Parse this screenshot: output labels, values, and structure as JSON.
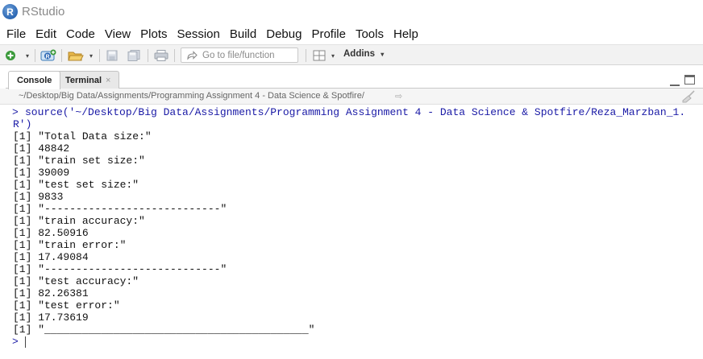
{
  "window": {
    "logo_letter": "R",
    "title": "RStudio"
  },
  "menu": [
    "File",
    "Edit",
    "Code",
    "View",
    "Plots",
    "Session",
    "Build",
    "Debug",
    "Profile",
    "Tools",
    "Help"
  ],
  "toolbar": {
    "goto_placeholder": "Go to file/function",
    "addins_label": "Addins"
  },
  "tabs": [
    {
      "label": "Console",
      "active": true
    },
    {
      "label": "Terminal",
      "active": false,
      "close": "×"
    }
  ],
  "path": "~/Desktop/Big Data/Assignments/Programming Assignment 4 - Data Science & Spotfire/",
  "console": {
    "prompt_symbol": ">",
    "command_line_1": "source('~/Desktop/Big Data/Assignments/Programming Assignment 4 - Data Science & Spotfire/Reza_Marzban_1.",
    "command_line_2": "R')",
    "output": [
      "[1] \"Total Data size:\"",
      "[1] 48842",
      "[1] \"train set size:\"",
      "[1] 39009",
      "[1] \"test set size:\"",
      "[1] 9833",
      "[1] \"----------------------------\"",
      "[1] \"train accuracy:\"",
      "[1] 82.50916",
      "[1] \"train error:\"",
      "[1] 17.49084",
      "[1] \"----------------------------\"",
      "[1] \"test accuracy:\"",
      "[1] 82.26381",
      "[1] \"test error:\"",
      "[1] 17.73619",
      "[1] \"__________________________________________\""
    ]
  },
  "colors": {
    "command_text": "#1a1aa6",
    "toolbar_bg": "#f2f2f2"
  },
  "icons": [
    "r-logo-icon",
    "new-file-icon",
    "new-project-icon",
    "open-folder-icon",
    "save-icon",
    "save-all-icon",
    "print-icon",
    "goto-arrow-icon",
    "grid-layout-icon",
    "minimize-icon",
    "maximize-icon",
    "path-forward-icon",
    "clear-console-broom-icon"
  ]
}
